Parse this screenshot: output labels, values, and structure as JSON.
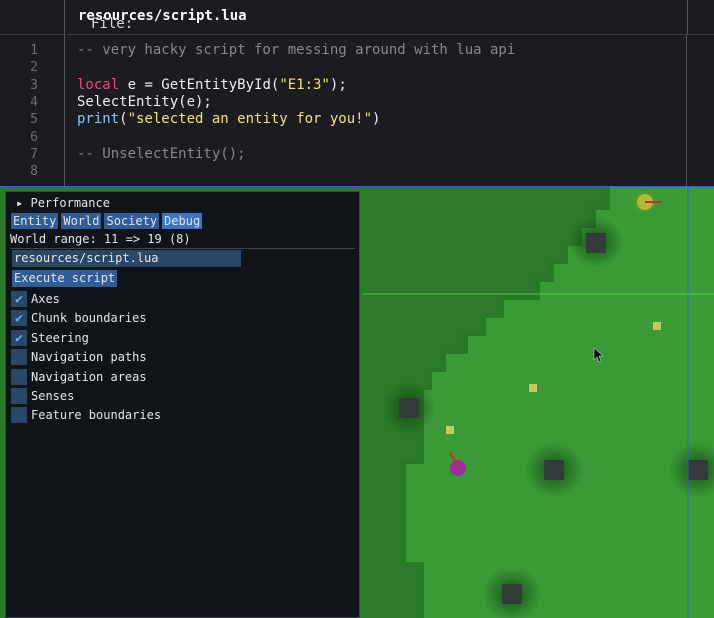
{
  "editor": {
    "file_label": "File:",
    "file_path": "resources/script.lua",
    "lines": [
      {
        "n": "1",
        "kind": "comment",
        "text": "-- very hacky script for messing around with lua api"
      },
      {
        "n": "2",
        "kind": "blank",
        "text": ""
      },
      {
        "n": "3",
        "kind": "local",
        "kw": "local",
        "mid": " e = GetEntityById(",
        "str": "\"E1:3\"",
        "end": ");"
      },
      {
        "n": "4",
        "kind": "plain",
        "text": "SelectEntity(e);"
      },
      {
        "n": "5",
        "kind": "print",
        "fn": "print",
        "open": "(",
        "str": "\"selected an entity for you!\"",
        "end": ")"
      },
      {
        "n": "6",
        "kind": "blank",
        "text": ""
      },
      {
        "n": "7",
        "kind": "comment",
        "text": "-- UnselectEntity();"
      },
      {
        "n": "8",
        "kind": "blank",
        "text": ""
      }
    ]
  },
  "panel": {
    "performance": "Performance",
    "tabs": [
      "Entity",
      "World",
      "Society",
      "Debug"
    ],
    "active_tab": "Debug",
    "world_range": "World range: 11 => 19 (8)",
    "script_path": "resources/script.lua",
    "execute_label": "Execute script",
    "checkboxes": [
      {
        "label": "Axes",
        "checked": true
      },
      {
        "label": "Chunk boundaries",
        "checked": true
      },
      {
        "label": "Steering",
        "checked": true
      },
      {
        "label": "Navigation paths",
        "checked": false
      },
      {
        "label": "Navigation areas",
        "checked": false
      },
      {
        "label": "Senses",
        "checked": false
      },
      {
        "label": "Feature boundaries",
        "checked": false
      }
    ]
  },
  "colors": {
    "grass_light": "#3a9b36",
    "grass_dark": "#2a7a2a",
    "chunk_line_blue": "#2f66c8",
    "chunk_line_green": "#48d048",
    "entity_purple": "#a02aa0",
    "entity_yellow": "#b8b836",
    "resource_yellow": "#c8c860",
    "block_dark": "#333a3a"
  }
}
